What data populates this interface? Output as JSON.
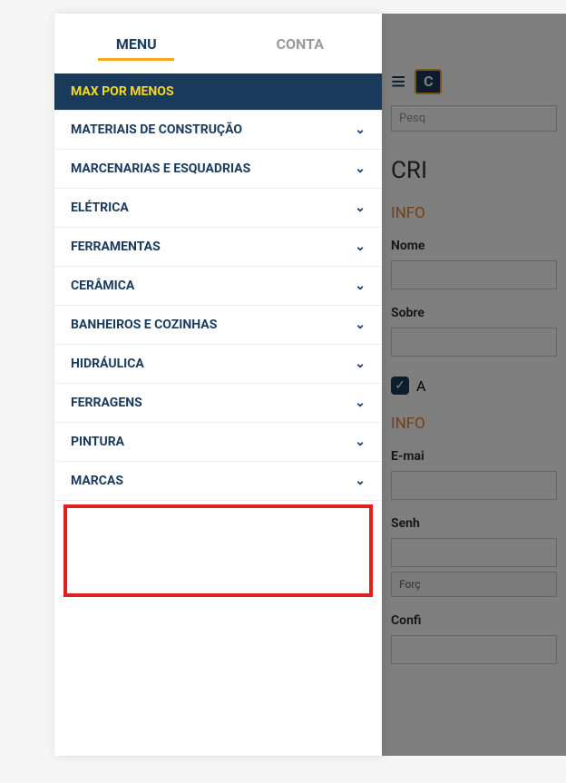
{
  "tabs": {
    "menu": "MENU",
    "conta": "CONTA"
  },
  "categories": {
    "highlighted": "MAX POR MENOS",
    "items": [
      "MATERIAIS DE CONSTRUÇÃO",
      "MARCENARIAS E ESQUADRIAS",
      "ELÉTRICA",
      "FERRAMENTAS",
      "CERÂMICA",
      "BANHEIROS E COZINHAS",
      "HIDRÁULICA",
      "FERRAGENS",
      "PINTURA",
      "MARCAS"
    ]
  },
  "background": {
    "search_placeholder": "Pesq",
    "title": "CRI",
    "section1": "INFO",
    "nome_label": "Nome",
    "sobre_label": "Sobre",
    "checkbox_label": "A",
    "section2": "INFO",
    "email_label": "E-mai",
    "senha_label": "Senh",
    "strength_label": "Forç",
    "confirm_label": "Confi"
  }
}
